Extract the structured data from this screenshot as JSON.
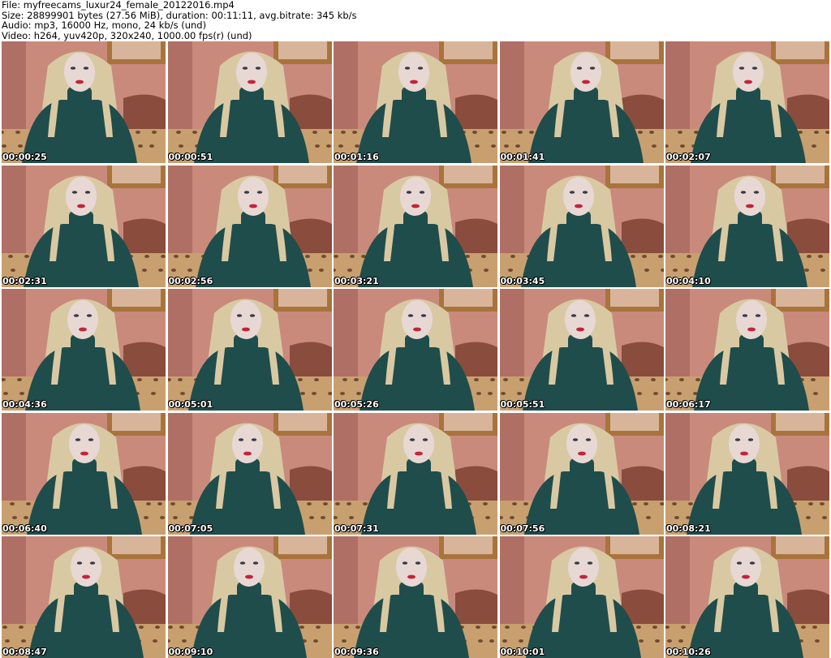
{
  "header": {
    "file": "File: myfreecams_luxur24_female_20122016.mp4",
    "size": "Size: 28899901 bytes (27.56 MiB), duration: 00:11:11, avg.bitrate: 345 kb/s",
    "audio": "Audio: mp3, 16000 Hz, mono, 24 kb/s (und)",
    "video": "Video: h264, yuv420p, 320x240, 1000.00 fps(r) (und)"
  },
  "colors": {
    "wall": "#c98a7c",
    "sweater": "#1f4d4b",
    "hair": "#d9c9a3",
    "skin": "#e8d8d4",
    "bedspread": "#c8a070",
    "picture_frame": "#a8743c"
  },
  "thumbnails": [
    {
      "timestamp": "00:00:25"
    },
    {
      "timestamp": "00:00:51"
    },
    {
      "timestamp": "00:01:16"
    },
    {
      "timestamp": "00:01:41"
    },
    {
      "timestamp": "00:02:07"
    },
    {
      "timestamp": "00:02:31"
    },
    {
      "timestamp": "00:02:56"
    },
    {
      "timestamp": "00:03:21"
    },
    {
      "timestamp": "00:03:45"
    },
    {
      "timestamp": "00:04:10"
    },
    {
      "timestamp": "00:04:36"
    },
    {
      "timestamp": "00:05:01"
    },
    {
      "timestamp": "00:05:26"
    },
    {
      "timestamp": "00:05:51"
    },
    {
      "timestamp": "00:06:17"
    },
    {
      "timestamp": "00:06:40"
    },
    {
      "timestamp": "00:07:05"
    },
    {
      "timestamp": "00:07:31"
    },
    {
      "timestamp": "00:07:56"
    },
    {
      "timestamp": "00:08:21"
    },
    {
      "timestamp": "00:08:47"
    },
    {
      "timestamp": "00:09:10"
    },
    {
      "timestamp": "00:09:36"
    },
    {
      "timestamp": "00:10:01"
    },
    {
      "timestamp": "00:10:26"
    }
  ]
}
